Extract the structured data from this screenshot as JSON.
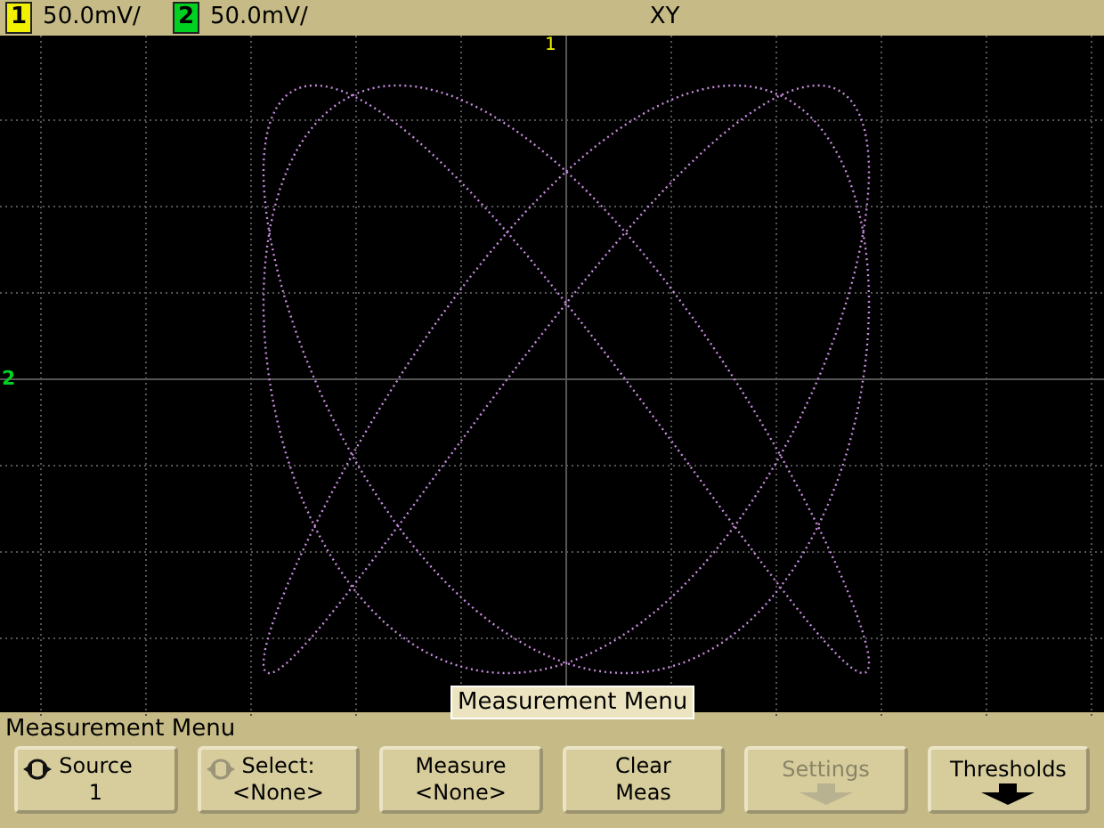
{
  "top_bar": {
    "channels": [
      {
        "number": "1",
        "scale": "50.0mV/",
        "color": "#f0f000"
      },
      {
        "number": "2",
        "scale": "50.0mV/",
        "color": "#00d020"
      }
    ],
    "mode": "XY"
  },
  "display": {
    "trigger_marker": "1",
    "ground_marker": "2",
    "overlay_label": "Measurement Menu"
  },
  "menu_title": "Measurement Menu",
  "softkeys": [
    {
      "label": "Source",
      "value": "1",
      "knob": true,
      "knob_dimmed": false,
      "disabled": false
    },
    {
      "label": "Select:",
      "value": "<None>",
      "knob": true,
      "knob_dimmed": true,
      "disabled": false
    },
    {
      "label": "Measure",
      "value": "<None>",
      "disabled": false
    },
    {
      "label": "Clear",
      "value": "Meas",
      "disabled": false
    },
    {
      "label": "Settings",
      "arrow": true,
      "disabled": true
    },
    {
      "label": "Thresholds",
      "arrow": true,
      "disabled": false
    }
  ]
}
